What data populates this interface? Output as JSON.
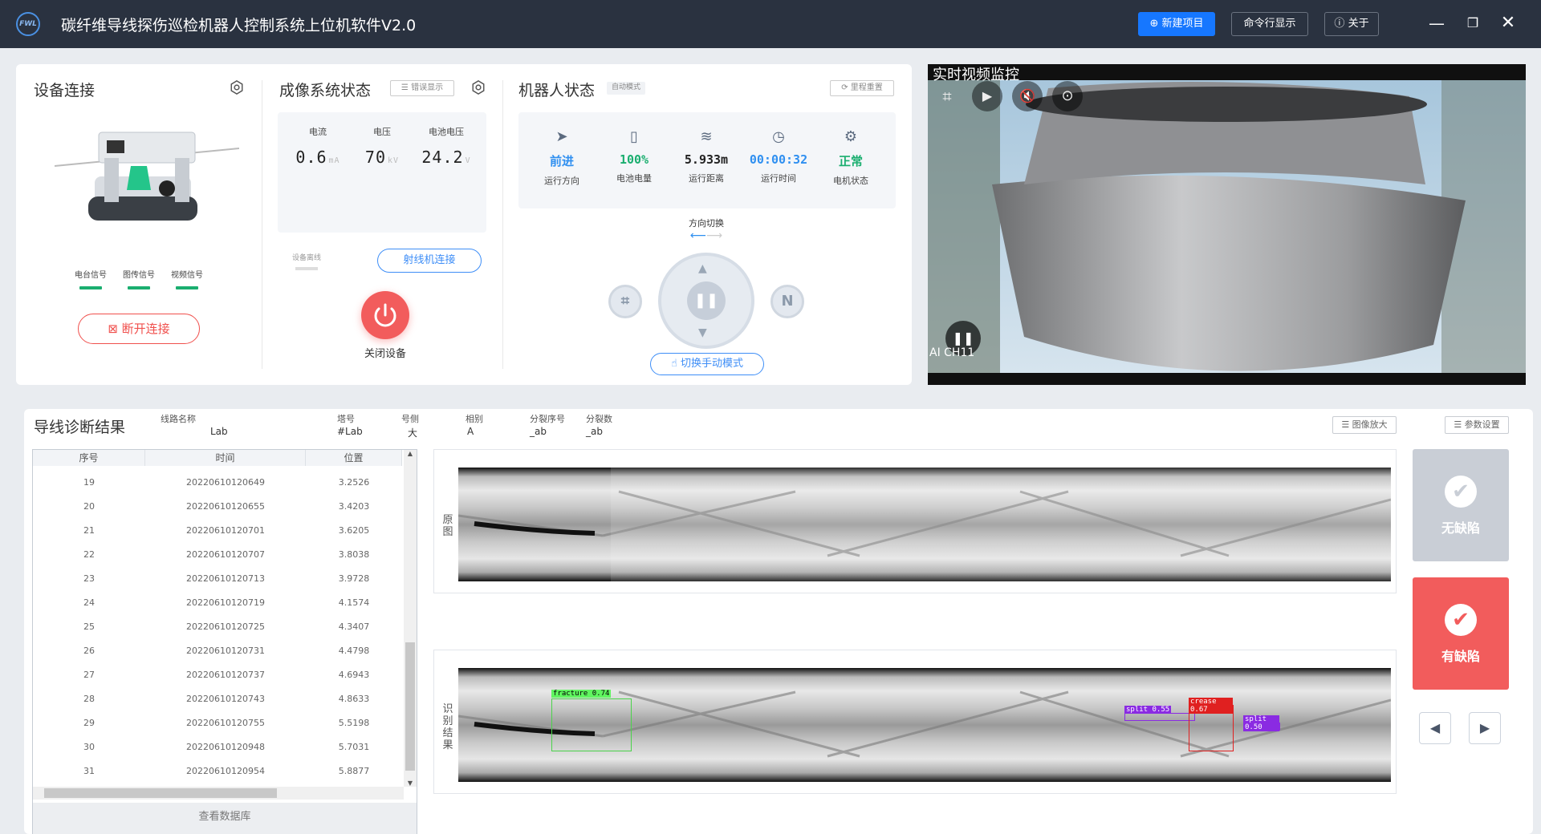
{
  "app": {
    "logo": "FWL",
    "title": "碳纤维导线探伤巡检机器人控制系统上位机软件V2.0",
    "buttons": {
      "new_project": "新建项目",
      "command_display": "命令行显示",
      "about": "关于"
    }
  },
  "device": {
    "title": "设备连接",
    "signals": [
      "电台信号",
      "图传信号",
      "视频信号"
    ],
    "disconnect": "断开连接"
  },
  "imaging": {
    "title": "成像系统状态",
    "error_display": "错误显示",
    "stats": [
      {
        "label": "电流",
        "value": "0.6",
        "unit": "mA"
      },
      {
        "label": "电压",
        "value": "70",
        "unit": "kV"
      },
      {
        "label": "电池电压",
        "value": "24.2",
        "unit": "V"
      }
    ],
    "offline": "设备离线",
    "xray_connect": "射线机连接",
    "shutdown": "关闭设备"
  },
  "robot": {
    "title": "机器人状态",
    "mode_tag": "自动模式",
    "reset": "里程重置",
    "items": [
      {
        "value": "前进",
        "label": "运行方向",
        "color": "#2f8ff0"
      },
      {
        "value": "100%",
        "label": "电池电量",
        "color": "#1aae6f"
      },
      {
        "value": "5.933m",
        "label": "运行距离",
        "color": "#222"
      },
      {
        "value": "00:00:32",
        "label": "运行时间",
        "color": "#2f8ff0"
      },
      {
        "value": "正常",
        "label": "电机状态",
        "color": "#1aae6f"
      }
    ],
    "direction_switch": "方向切换",
    "n_label": "N",
    "manual_mode": "切换手动模式"
  },
  "video": {
    "title": "实时视频监控",
    "overlay_text": "AI CH11"
  },
  "diagnosis": {
    "title": "导线诊断结果",
    "fields": [
      {
        "label": "线路名称",
        "value": "Lab"
      },
      {
        "label": "塔号",
        "value": "#Lab"
      },
      {
        "label": "号侧",
        "value": "大"
      },
      {
        "label": "相别",
        "value": "A"
      },
      {
        "label": "分裂序号",
        "value": "_ab"
      },
      {
        "label": "分裂数",
        "value": "_ab"
      }
    ],
    "zoom": "图像放大",
    "params": "参数设置",
    "table": {
      "headers": [
        "序号",
        "时间",
        "位置"
      ],
      "rows": [
        [
          "19",
          "20220610120649",
          "3.2526"
        ],
        [
          "20",
          "20220610120655",
          "3.4203"
        ],
        [
          "21",
          "20220610120701",
          "3.6205"
        ],
        [
          "22",
          "20220610120707",
          "3.8038"
        ],
        [
          "23",
          "20220610120713",
          "3.9728"
        ],
        [
          "24",
          "20220610120719",
          "4.1574"
        ],
        [
          "25",
          "20220610120725",
          "4.3407"
        ],
        [
          "26",
          "20220610120731",
          "4.4798"
        ],
        [
          "27",
          "20220610120737",
          "4.6943"
        ],
        [
          "28",
          "20220610120743",
          "4.8633"
        ],
        [
          "29",
          "20220610120755",
          "5.5198"
        ],
        [
          "30",
          "20220610120948",
          "5.7031"
        ],
        [
          "31",
          "20220610120954",
          "5.8877"
        ]
      ],
      "footer": "查看数据库"
    },
    "original_label": "原图",
    "recognition_label": "识别结果",
    "detections": [
      "fracture 0.74",
      "split 0.55",
      "crease 0.67",
      "split 0.50"
    ],
    "no_defect": "无缺陷",
    "has_defect": "有缺陷"
  }
}
